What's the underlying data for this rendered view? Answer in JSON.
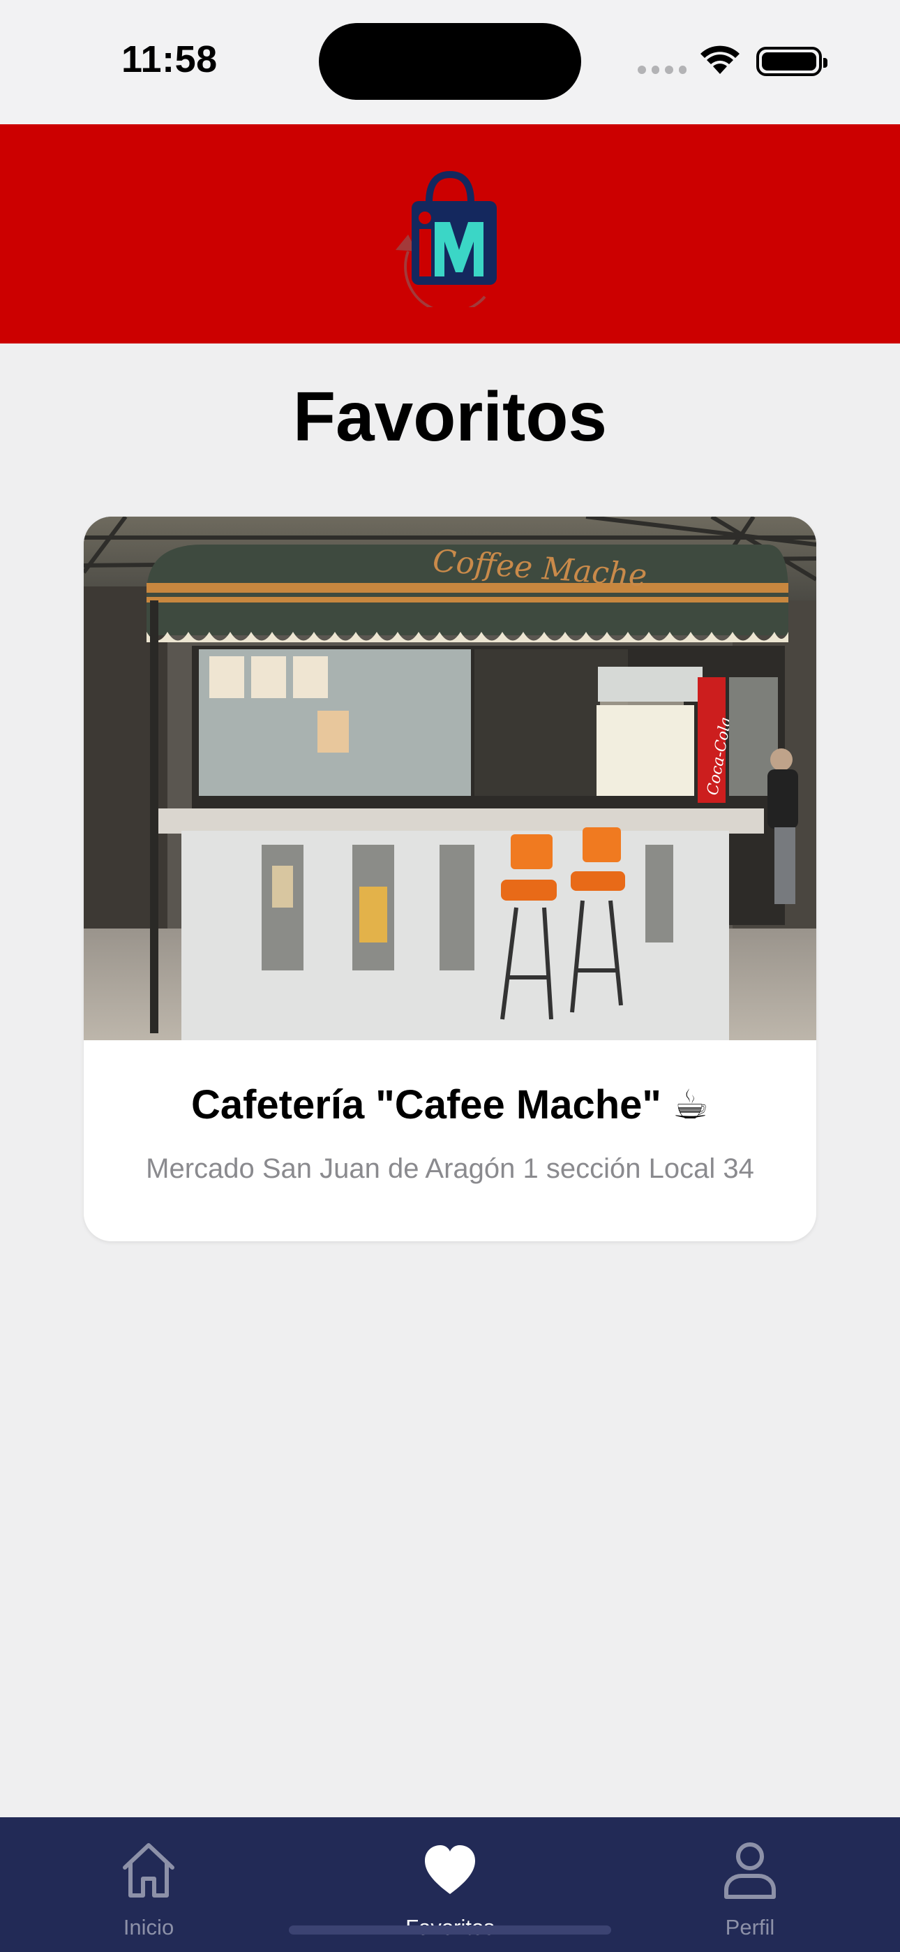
{
  "status_bar": {
    "time": "11:58"
  },
  "header": {
    "logo_text": "iM",
    "background": "#cc0000"
  },
  "page": {
    "title": "Favoritos"
  },
  "favorites": [
    {
      "name": "Cafetería \"Cafee Mache\" ☕",
      "address": "Mercado San Juan de Aragón 1 sección Local 34",
      "photo_sign": "Coffee Mache",
      "photo_sign_2": "Coca-Cola"
    }
  ],
  "tab_bar": {
    "background": "#222a56",
    "tabs": [
      {
        "label": "Inicio",
        "icon": "home-icon",
        "active": false
      },
      {
        "label": "Favoritos",
        "icon": "heart-icon",
        "active": true
      },
      {
        "label": "Perfil",
        "icon": "person-icon",
        "active": false
      }
    ]
  }
}
